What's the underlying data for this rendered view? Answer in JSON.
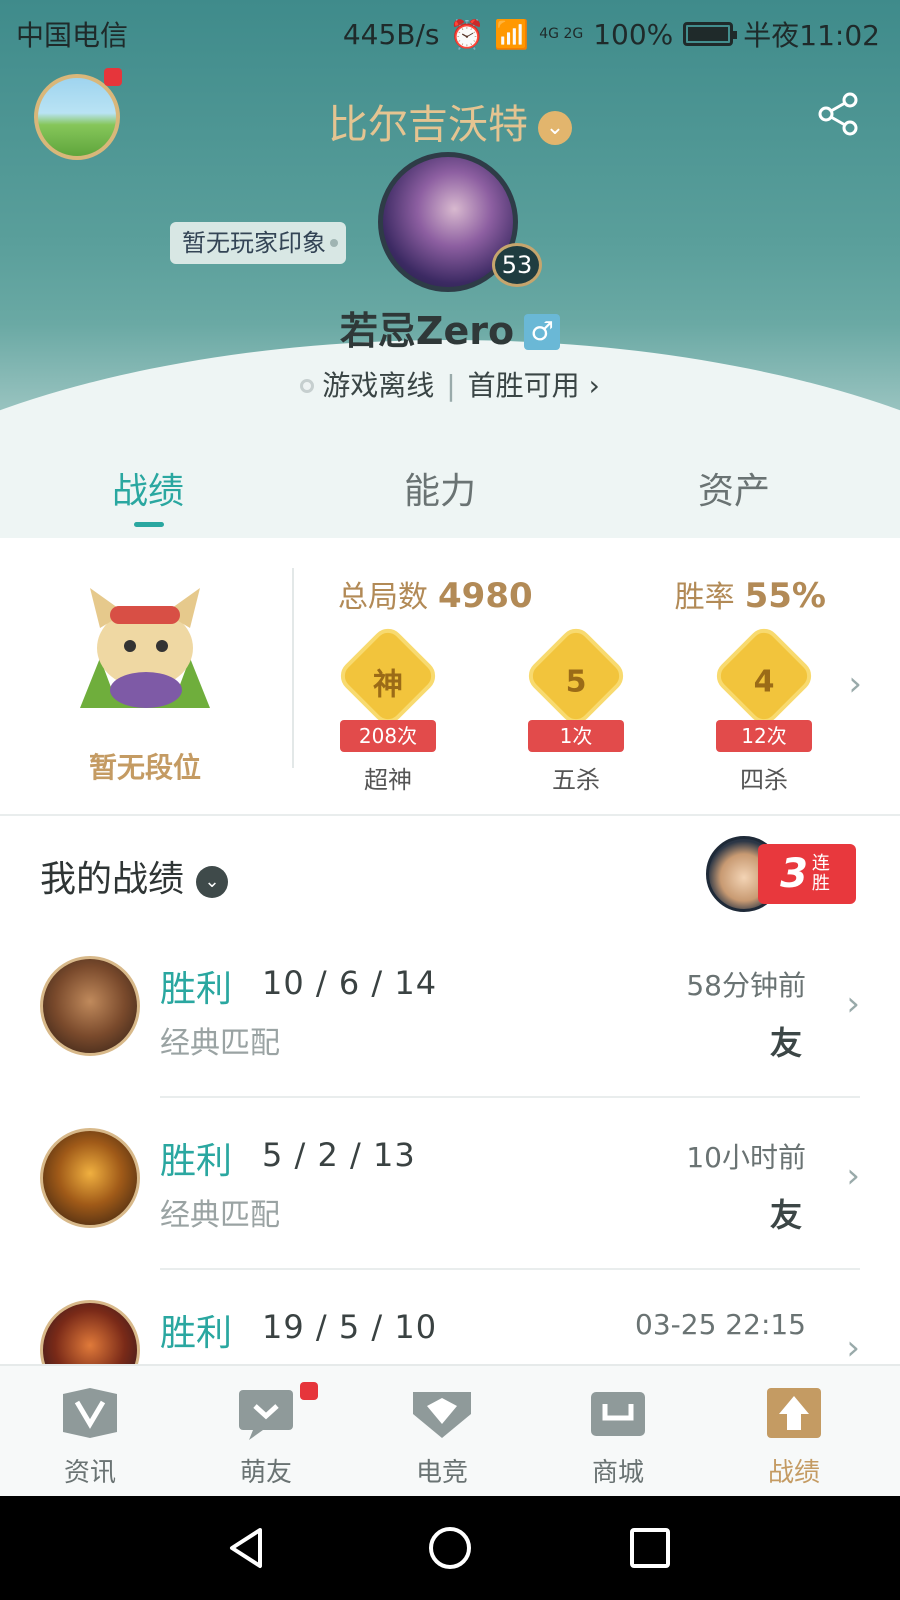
{
  "status_bar": {
    "carrier": "中国电信",
    "speed": "445B/s",
    "network": "4G 2G",
    "battery": "100%",
    "time": "半夜11:02"
  },
  "header": {
    "server": "比尔吉沃特",
    "impression": "暂无玩家印象",
    "level": "53",
    "nickname": "若忌Zero",
    "gender_icon": "♂",
    "status": "游戏离线",
    "first_win": "首胜可用 ›"
  },
  "tabs": [
    {
      "label": "战绩",
      "active": true
    },
    {
      "label": "能力",
      "active": false
    },
    {
      "label": "资产",
      "active": false
    }
  ],
  "stats": {
    "rank_text": "暂无段位",
    "total_label": "总局数",
    "total_value": "4980",
    "winrate_label": "胜率",
    "winrate_value": "55%",
    "badges": [
      {
        "glyph": "神",
        "count": "208次",
        "label": "超神"
      },
      {
        "glyph": "5",
        "count": "1次",
        "label": "五杀"
      },
      {
        "glyph": "4",
        "count": "12次",
        "label": "四杀"
      }
    ]
  },
  "records": {
    "title": "我的战绩",
    "streak_num": "3",
    "streak_text": "连胜",
    "rows": [
      {
        "result": "胜利",
        "kda": "10 / 6 / 14",
        "mode": "经典匹配",
        "time": "58分钟前",
        "friend": "友"
      },
      {
        "result": "胜利",
        "kda": "5 / 2 / 13",
        "mode": "经典匹配",
        "time": "10小时前",
        "friend": "友"
      },
      {
        "result": "胜利",
        "kda": "19 / 5 / 10",
        "mode": "",
        "time": "03-25 22:15",
        "friend": ""
      }
    ]
  },
  "bottom_nav": [
    {
      "label": "资讯",
      "icon": "news-icon"
    },
    {
      "label": "萌友",
      "icon": "friends-icon"
    },
    {
      "label": "电竞",
      "icon": "esports-icon"
    },
    {
      "label": "商城",
      "icon": "shop-icon"
    },
    {
      "label": "战绩",
      "icon": "record-icon",
      "active": true
    }
  ],
  "colors": {
    "accent": "#2aa7a0",
    "gold": "#c49b63",
    "header": "#4f9794"
  }
}
